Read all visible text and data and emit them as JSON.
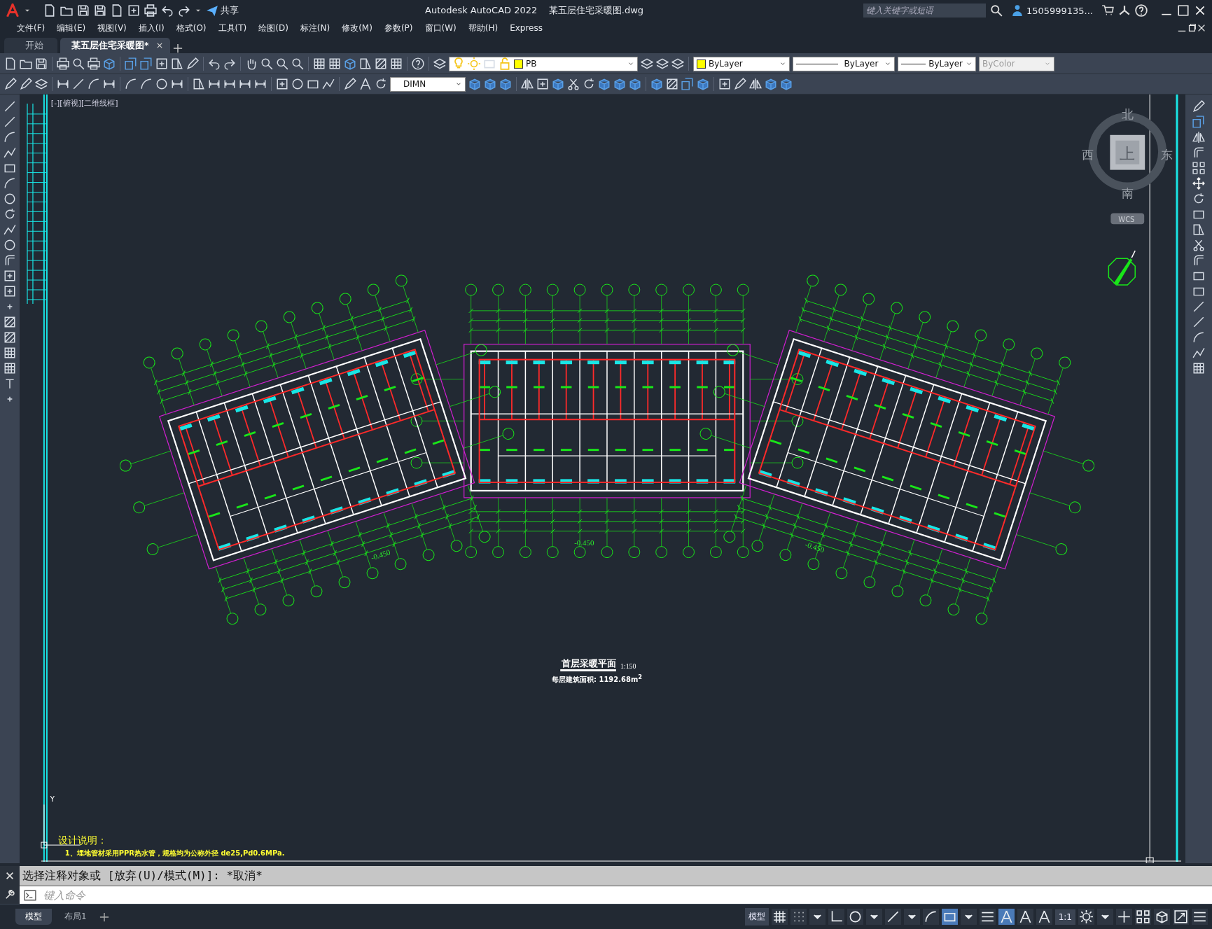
{
  "title_bar": {
    "share": "共享",
    "title": "Autodesk AutoCAD 2022    某五层住宅采暖图.dwg",
    "search": {
      "placeholder": "键入关键字或短语"
    },
    "user": "1505999135..."
  },
  "menu": [
    "文件(F)",
    "编辑(E)",
    "视图(V)",
    "插入(I)",
    "格式(O)",
    "工具(T)",
    "绘图(D)",
    "标注(N)",
    "修改(M)",
    "参数(P)",
    "窗口(W)",
    "帮助(H)",
    "Express"
  ],
  "tabs": [
    {
      "label": "开始",
      "selected": false,
      "closable": false
    },
    {
      "label": "某五层住宅采暖图*",
      "selected": true,
      "closable": true
    }
  ],
  "toolbar": {
    "layer": "PB",
    "object_color": "ByLayer",
    "linetype": "ByLayer",
    "lineweight": "ByLayer",
    "plot_style": {
      "label": "ByColor",
      "disabled": true
    },
    "dim_style": "DIMN"
  },
  "viewport_label": "[-][俯视][二维线框]",
  "viewcube": {
    "top": "上",
    "north": "北",
    "south": "南",
    "east": "东",
    "west": "西",
    "ucs": "WCS"
  },
  "drawing": {
    "level_marks": [
      "-0.450",
      "-0.450",
      "-0.450"
    ],
    "title": "首层采暖平面",
    "scale": "1:150",
    "area_note": "每层建筑面积: 1192.68m$^{2}$",
    "notes_heading": "设计说明：",
    "notes": [
      "1、埋地管材采用PPR热水管，规格均为公称外径 de25,Pd0.6MPa."
    ],
    "ucs_y": "Y"
  },
  "command_line": {
    "history": "选择注释对象或 [放弃(U)/模式(M)]: *取消*",
    "placeholder": "键入命令"
  },
  "layout_tabs": [
    {
      "label": "模型",
      "selected": true
    },
    {
      "label": "布局1",
      "selected": false
    }
  ],
  "status_bar": {
    "model": "模型",
    "scale": "1:1"
  }
}
